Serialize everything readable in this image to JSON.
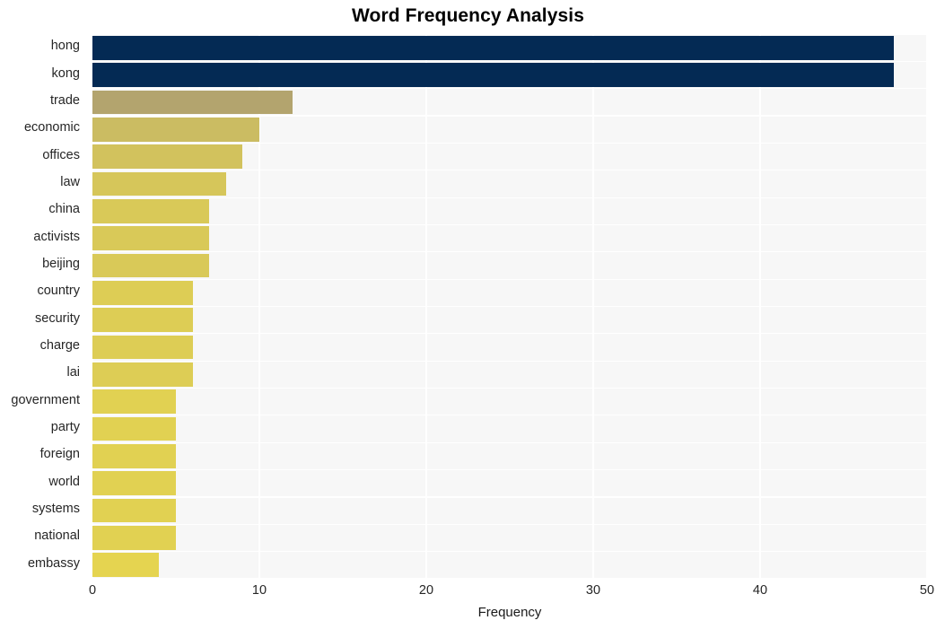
{
  "chart_data": {
    "type": "bar",
    "orientation": "horizontal",
    "title": "Word Frequency Analysis",
    "xlabel": "Frequency",
    "ylabel": "",
    "xlim": [
      0,
      50
    ],
    "xticks": [
      0,
      10,
      20,
      30,
      40,
      50
    ],
    "xtick_labels": [
      "0",
      "10",
      "20",
      "30",
      "40",
      "50"
    ],
    "grid": true,
    "legend": null,
    "categories": [
      "hong",
      "kong",
      "trade",
      "economic",
      "offices",
      "law",
      "china",
      "activists",
      "beijing",
      "country",
      "security",
      "charge",
      "lai",
      "government",
      "party",
      "foreign",
      "world",
      "systems",
      "national",
      "embassy"
    ],
    "values": [
      48,
      48,
      12,
      10,
      9,
      8,
      7,
      7,
      7,
      6,
      6,
      6,
      6,
      5,
      5,
      5,
      5,
      5,
      5,
      4
    ],
    "bar_colors": [
      "#042a54",
      "#042a54",
      "#b3a46e",
      "#cbbc62",
      "#d2c25d",
      "#d6c65a",
      "#d9c958",
      "#d9c958",
      "#d9c958",
      "#ddcd55",
      "#ddcd55",
      "#ddcd55",
      "#ddcd55",
      "#e1d152",
      "#e1d152",
      "#e1d152",
      "#e1d152",
      "#e1d152",
      "#e1d152",
      "#e5d450"
    ],
    "plot_background": "#f7f7f7",
    "grid_color": "#ffffff",
    "figure_background": "#ffffff"
  }
}
